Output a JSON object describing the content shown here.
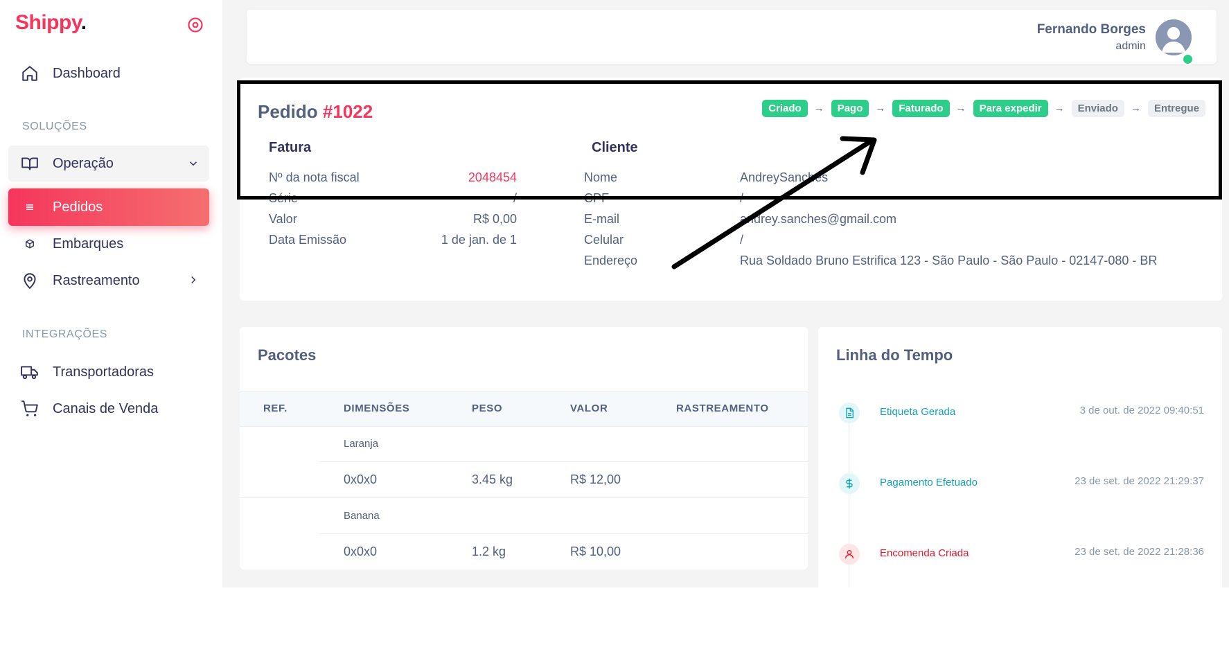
{
  "brand": {
    "name": "Shippy",
    "dot": "."
  },
  "sidebar": {
    "dashboard": "Dashboard",
    "solutions_label": "SOLUÇÕES",
    "operacao": "Operação",
    "pedidos": "Pedidos",
    "embarques": "Embarques",
    "rastreamento": "Rastreamento",
    "integrations_label": "INTEGRAÇÕES",
    "transportadoras": "Transportadoras",
    "canais": "Canais de Venda"
  },
  "user": {
    "name": "Fernando Borges",
    "role": "admin"
  },
  "order": {
    "title": "Pedido",
    "number": "#1022",
    "steps": [
      {
        "label": "Criado",
        "done": true
      },
      {
        "label": "Pago",
        "done": true
      },
      {
        "label": "Faturado",
        "done": true
      },
      {
        "label": "Para expedir",
        "done": true
      },
      {
        "label": "Enviado",
        "done": false
      },
      {
        "label": "Entregue",
        "done": false
      }
    ],
    "invoice": {
      "heading": "Fatura",
      "nf_label": "Nº da nota fiscal",
      "nf_value": "2048454",
      "serie_label": "Série",
      "serie_value": "/",
      "valor_label": "Valor",
      "valor_value": "R$ 0,00",
      "data_label": "Data Emissão",
      "data_value": "1 de jan. de 1"
    },
    "client": {
      "heading": "Cliente",
      "nome_label": "Nome",
      "nome_value": "AndreySanches",
      "cpf_label": "CPF",
      "cpf_value": "/",
      "email_label": "E-mail",
      "email_value": "andrey.sanches@gmail.com",
      "celular_label": "Celular",
      "celular_value": "/",
      "endereco_label": "Endereço",
      "endereco_value": "Rua Soldado Bruno Estrifica 123 - São Paulo - São Paulo - 02147-080 - BR"
    }
  },
  "packages": {
    "title": "Pacotes",
    "columns": [
      "REF.",
      "DIMENSÕES",
      "PESO",
      "VALOR",
      "RASTREAMENTO"
    ],
    "items": [
      {
        "name": "Laranja",
        "dims": "0x0x0",
        "weight": "3.45 kg",
        "value": "R$ 12,00"
      },
      {
        "name": "Banana",
        "dims": "0x0x0",
        "weight": "1.2 kg",
        "value": "R$ 10,00"
      }
    ]
  },
  "timeline": {
    "title": "Linha do Tempo",
    "events": [
      {
        "label": "Etiqueta Gerada",
        "date": "3 de out. de 2022 09:40:51",
        "icon": "document-icon",
        "color": "#11a3b5"
      },
      {
        "label": "Pagamento Efetuado",
        "date": "23 de set. de 2022 21:29:37",
        "icon": "dollar-icon",
        "color": "#11a3b5"
      },
      {
        "label": "Encomenda Criada",
        "date": "23 de set. de 2022 21:28:36",
        "icon": "user-icon",
        "color": "#e0162b"
      }
    ]
  },
  "colors": {
    "accent": "#f5365c",
    "success": "#2dce89",
    "teal": "#11a3b5"
  }
}
